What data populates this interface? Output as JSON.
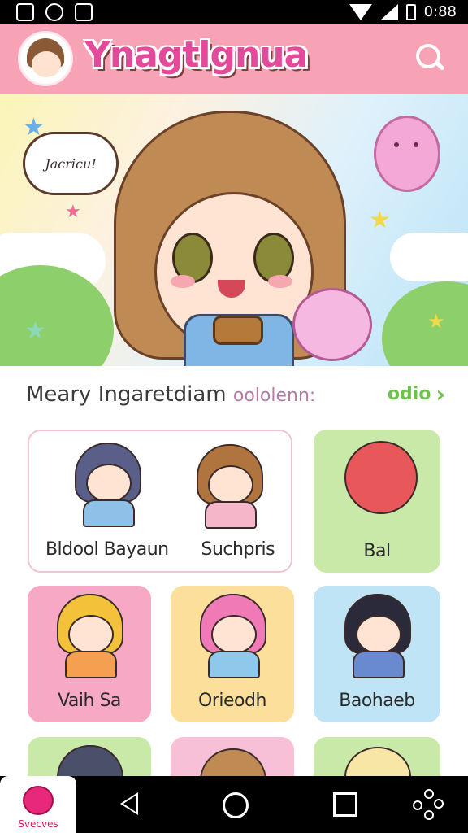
{
  "status_bar": {
    "time": "0:88"
  },
  "header": {
    "app_title": "Ynagtlgnua"
  },
  "banner": {
    "speech_text": "Jacricu!"
  },
  "section": {
    "title": "Meary Ingaretdiam",
    "subtitle": "oololenn:",
    "more_label": "odio"
  },
  "cards": [
    {
      "labels": [
        "Bldool Bayaun",
        "Suchpris"
      ]
    },
    {
      "labels": [
        "Bal"
      ]
    },
    {
      "labels": [
        "Vaih Sa"
      ]
    },
    {
      "labels": [
        "Orieodh"
      ]
    },
    {
      "labels": [
        "Baohaeb"
      ]
    }
  ],
  "nav": {
    "home_label": "Svecves"
  },
  "colors": {
    "header": "#f7a2b5",
    "accent_green": "#6cc24a",
    "accent_pink": "#e8287a"
  },
  "icons": [
    "search-icon",
    "back-icon",
    "home-icon",
    "recents-icon",
    "network-icon"
  ]
}
